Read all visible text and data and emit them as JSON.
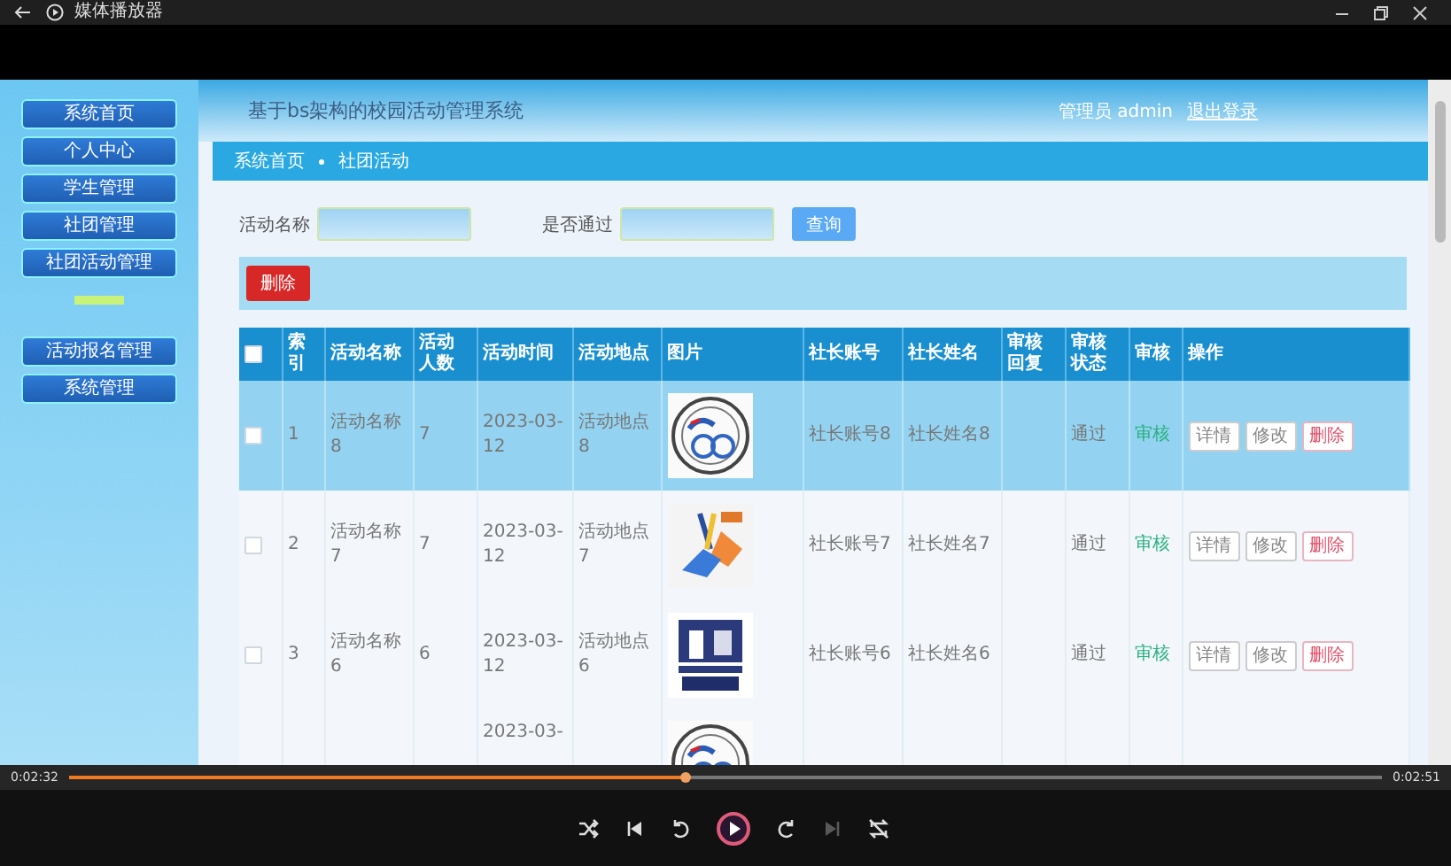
{
  "window": {
    "title": "媒体播放器"
  },
  "page": {
    "system_title": "基于bs架构的校园活动管理系统",
    "user_label": "管理员 admin",
    "logout": "退出登录",
    "sidebar": {
      "items": [
        {
          "kind": "button",
          "label": "系统首页"
        },
        {
          "kind": "button",
          "label": "个人中心"
        },
        {
          "kind": "button",
          "label": "学生管理"
        },
        {
          "kind": "button",
          "label": "社团管理"
        },
        {
          "kind": "button",
          "label": "社团活动管理"
        },
        {
          "kind": "divider"
        },
        {
          "kind": "button",
          "label": "活动报名管理"
        },
        {
          "kind": "button",
          "label": "系统管理"
        }
      ]
    },
    "breadcrumb": [
      "系统首页",
      "社团活动"
    ],
    "search": {
      "fields": [
        {
          "label": "活动名称"
        },
        {
          "label": "是否通过"
        }
      ],
      "button": "查询"
    },
    "toolbar": {
      "delete_button": "删除"
    },
    "table": {
      "select_all": {
        "checked": false
      },
      "columns": [
        "索引",
        "活动名称",
        "活动人数",
        "活动时间",
        "活动地点",
        "图片",
        "社长账号",
        "社长姓名",
        "审核回复",
        "审核状态",
        "审核",
        "操作"
      ],
      "rows": [
        {
          "selected": true,
          "checked": false,
          "index": "1",
          "name": "活动名称8",
          "people": "7",
          "time": "2023-03-12",
          "place": "活动地点8",
          "picture": {
            "kind": "picture"
          },
          "leader_account": "社长账号8",
          "leader_name": "社长姓名8",
          "status": "通过",
          "review": "审核",
          "actions": [
            "详情",
            "修改",
            "删除"
          ]
        },
        {
          "selected": false,
          "checked": false,
          "index": "2",
          "name": "活动名称7",
          "people": "7",
          "time": "2023-03-12",
          "place": "活动地点7",
          "picture": {
            "kind": "picture"
          },
          "leader_account": "社长账号7",
          "leader_name": "社长姓名7",
          "status": "通过",
          "review": "审核",
          "actions": [
            "详情",
            "修改",
            "删除"
          ]
        },
        {
          "selected": false,
          "checked": false,
          "index": "3",
          "name": "活动名称6",
          "people": "6",
          "time": "2023-03-12",
          "place": "活动地点6",
          "picture": {
            "kind": "picture"
          },
          "leader_account": "社长账号6",
          "leader_name": "社长姓名6",
          "status": "通过",
          "review": "审核",
          "actions": [
            "详情",
            "修改",
            "删除"
          ]
        },
        {
          "selected": false,
          "time": "2023-03-",
          "picture": {
            "kind": "picture"
          }
        }
      ]
    }
  },
  "player": {
    "elapsed": "0:02:32",
    "total": "0:02:51",
    "level": 0.47,
    "controls": [
      {
        "kind": "shuffle",
        "disabled": false
      },
      {
        "kind": "previous",
        "disabled": false
      },
      {
        "kind": "rewind",
        "disabled": false
      },
      {
        "kind": "play",
        "disabled": false
      },
      {
        "kind": "forward",
        "disabled": false
      },
      {
        "kind": "next",
        "disabled": true
      },
      {
        "kind": "repeat",
        "disabled": false
      }
    ]
  }
}
